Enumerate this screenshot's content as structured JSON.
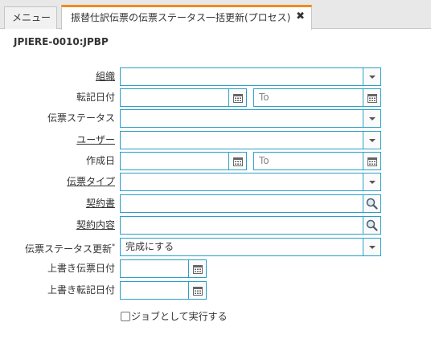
{
  "tabs": [
    {
      "label": "メニュー"
    },
    {
      "label": "振替仕訳伝票の伝票ステータス一括更新(プロセス)"
    }
  ],
  "close_symbol": "✖",
  "doc_id": "JPIERE-0010:JPBP",
  "form": {
    "org": {
      "label": "組織",
      "value": ""
    },
    "account_date": {
      "label": "転記日付",
      "from": "",
      "to_placeholder": "To"
    },
    "doc_status": {
      "label": "伝票ステータス",
      "value": ""
    },
    "user": {
      "label": "ユーザー",
      "value": ""
    },
    "created": {
      "label": "作成日",
      "from": "",
      "to_placeholder": "To"
    },
    "doc_type": {
      "label": "伝票タイプ",
      "value": ""
    },
    "contract": {
      "label": "契約書",
      "value": ""
    },
    "contract_content": {
      "label": "契約内容",
      "value": ""
    },
    "doc_status_update": {
      "label": "伝票ステータス更新",
      "required_mark": "*",
      "value": "完成にする"
    },
    "overwrite_doc_date": {
      "label": "上書き伝票日付",
      "value": ""
    },
    "overwrite_account_date": {
      "label": "上書き転記日付",
      "value": ""
    }
  },
  "run_as_job": {
    "label": "ジョブとして実行する",
    "checked": false
  },
  "icons": {
    "dropdown": "chevron-down-icon",
    "calendar": "calendar-icon",
    "search": "magnifier-icon"
  },
  "colors": {
    "accent": "#f08c1c",
    "field_border": "#2aa0c7"
  }
}
